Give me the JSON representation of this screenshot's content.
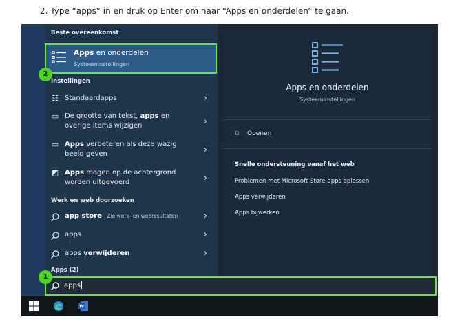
{
  "instruction": "2. Type “apps” in en druk op Enter om naar “Apps en onderdelen” te gaan.",
  "colors": {
    "highlight_border": "#6ee24a",
    "badge": "#4fd12a",
    "selected_bg": "#2b5b86"
  },
  "left_panel": {
    "best_match_header": "Beste overeenkomst",
    "best_match": {
      "title_bold": "Apps",
      "title_rest": " en onderdelen",
      "subtitle": "Systeeminstellingen",
      "icon": "list-settings-icon"
    },
    "settings_header": "Instellingen",
    "settings_items": [
      {
        "pre": "",
        "bold": "",
        "post": "Standaardapps",
        "icon": "default-apps-icon"
      },
      {
        "pre": "De grootte van tekst, ",
        "bold": "apps",
        "post": " en overige items wijzigen",
        "icon": "display-icon"
      },
      {
        "pre": "",
        "bold": "Apps",
        "post": " verbeteren als deze wazig beeld geven",
        "icon": "display-icon"
      },
      {
        "pre": "",
        "bold": "Apps",
        "post": " mogen op de achtergrond worden uitgevoerd",
        "icon": "background-apps-icon"
      }
    ],
    "web_header": "Werk en web doorzoeken",
    "web_items": [
      {
        "bold": "app store",
        "sub": " - Zie werk- en webresultaten",
        "icon": "search-icon"
      },
      {
        "normal": "apps",
        "icon": "search-icon"
      },
      {
        "normal": "apps ",
        "bold": "verwijderen",
        "icon": "search-icon"
      }
    ],
    "apps_header": "Apps (2)"
  },
  "right_panel": {
    "title": "Apps en onderdelen",
    "subtitle": "Systeeminstellingen",
    "open_label": "Openen",
    "quick_help_header": "Snelle ondersteuning vanaf het web",
    "links": [
      "Problemen met Microsoft Store-apps oplossen",
      "Apps verwijderen",
      "Apps bijwerken"
    ]
  },
  "search": {
    "value": "apps"
  },
  "badges": {
    "step1": "1",
    "step2": "2"
  },
  "taskbar": {
    "icons": [
      "windows-start-icon",
      "edge-icon",
      "word-icon"
    ]
  }
}
